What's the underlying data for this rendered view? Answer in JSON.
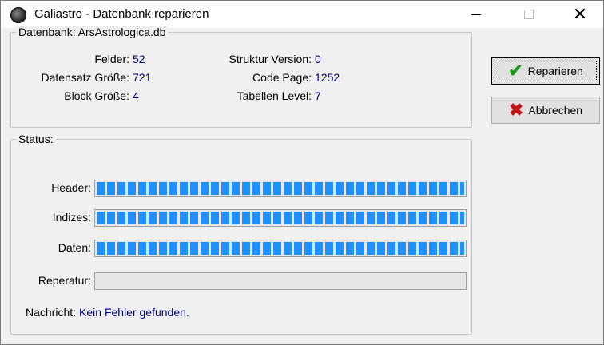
{
  "window": {
    "title": "Galiastro - Datenbank reparieren"
  },
  "database": {
    "legend": "Datenbank: ArsAstrologica.db",
    "fields": [
      {
        "label": "Felder:",
        "value": "52"
      },
      {
        "label": "Datensatz Größe:",
        "value": "721"
      },
      {
        "label": "Block Größe:",
        "value": "4"
      },
      {
        "label": "Struktur Version:",
        "value": "0"
      },
      {
        "label": "Code Page:",
        "value": "1252"
      },
      {
        "label": "Tabellen Level:",
        "value": "7"
      }
    ]
  },
  "status": {
    "legend": "Status:",
    "progress": [
      {
        "label": "Header:",
        "percent": 100
      },
      {
        "label": "Indizes:",
        "percent": 100
      },
      {
        "label": "Daten:",
        "percent": 100
      },
      {
        "label": "Reperatur:",
        "percent": 0
      }
    ],
    "message_label": "Nachricht:",
    "message_value": "Kein Fehler gefunden."
  },
  "buttons": {
    "repair": "Reparieren",
    "cancel": "Abbrechen"
  },
  "icons": {
    "repair": "check-icon",
    "cancel": "x-icon",
    "progress_color": "#1e90ff",
    "value_color": "#000080"
  }
}
